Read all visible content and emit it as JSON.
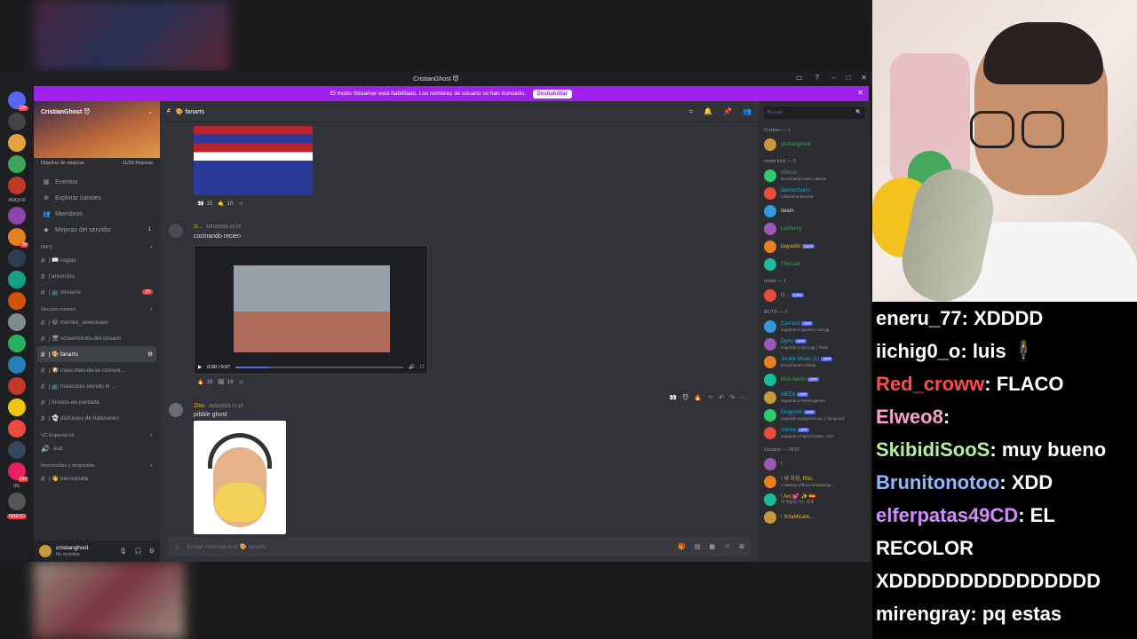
{
  "app": {
    "window_title": "CristianGhost 😈",
    "streamer_banner": "El modo Streamer está habilitado. Los nombres de usuario se han truncado.",
    "streamer_button": "Deshabilitar"
  },
  "servers": [
    {
      "badge": "226"
    },
    {
      "badge": ""
    },
    {
      "badge": ""
    },
    {
      "badge": ""
    },
    {
      "badge": ""
    },
    {
      "badge": ""
    },
    {
      "badge": "28"
    },
    {
      "badge": ""
    },
    {
      "badge": ""
    },
    {
      "badge": ""
    },
    {
      "badge": ""
    },
    {
      "badge": ""
    },
    {
      "badge": ""
    },
    {
      "badge": ""
    },
    {
      "badge": ""
    },
    {
      "badge": ""
    },
    {
      "badge": ""
    },
    {
      "badge": "299"
    },
    {
      "badge": ""
    }
  ],
  "server_labels": {
    "niqui": "4NIQUI2",
    "irl": "IRL",
    "nuevo": "NUEVO"
  },
  "sidebar": {
    "server_name": "CristianGhost 😈",
    "boost_goal": "Objetivo de mejoras",
    "boost_count": "11/28 Mejoras",
    "nav": [
      {
        "icon": "calendar-icon",
        "label": "Eventos"
      },
      {
        "icon": "compass-icon",
        "label": "Explorar canales"
      },
      {
        "icon": "members-icon",
        "label": "Miembros"
      },
      {
        "icon": "boost-icon",
        "label": "Mejoras del servidor",
        "count": "1"
      }
    ],
    "categories": [
      {
        "name": "INFO",
        "channels": [
          {
            "name": "| 📖 reglas",
            "count": ""
          },
          {
            "name": "| anuncios",
            "count": ""
          },
          {
            "name": "| 📺 streams",
            "count": "29"
          }
        ]
      },
      {
        "name": "Sección memes",
        "channels": [
          {
            "name": "| 😂 memes_aweonaso",
            "count": ""
          },
          {
            "name": "| 🖥 screenshots-del-stream",
            "count": ""
          },
          {
            "name": "| 🎨 fanarts",
            "count": "",
            "active": true
          },
          {
            "name": "| 🐶 mascotas-de-la-comuni...",
            "count": ""
          },
          {
            "name": "| 📺 mascotas viendo el ...",
            "count": ""
          },
          {
            "name": "| fondos-de-pantalla",
            "count": ""
          },
          {
            "name": "| 👻 disfraces de halloween",
            "count": ""
          }
        ]
      },
      {
        "name": "VC Especial lol",
        "channels": [
          {
            "name": "asd",
            "count": ""
          }
        ]
      },
      {
        "name": "bienvenidas y despedida",
        "channels": [
          {
            "name": "| 👋 bienvenida",
            "count": ""
          }
        ]
      }
    ],
    "user": {
      "name": "cristianghost",
      "status": "No molestar"
    }
  },
  "chat": {
    "channel": "🎨 fanarts",
    "reactions_1": [
      {
        "emoji": "👀",
        "count": "15"
      },
      {
        "emoji": "🤙",
        "count": "10"
      }
    ],
    "messages": [
      {
        "author": "D...",
        "timestamp": "19/10/2025 10:19",
        "text": "cocinando recien",
        "video_time": "0:00 / 0:07"
      },
      {
        "author": "Zitto",
        "timestamp": "19/10/2025 17:13",
        "text": "pibble ghost"
      }
    ],
    "reactions_2": [
      {
        "emoji": "🔥",
        "count": "18"
      },
      {
        "emoji": "🖼",
        "count": "16"
      }
    ],
    "composer_placeholder": "Enviar mensaje a #| 🎨 fanarts"
  },
  "members": {
    "search_placeholder": "Buscar",
    "groups": [
      {
        "title": "Cristian — 1",
        "members": [
          {
            "name": "cristianghost",
            "status": "",
            "color": "#3ba55c",
            "tag": ""
          }
        ]
      },
      {
        "title": "mods kick — 6",
        "members": [
          {
            "name": "IGhost",
            "status": "Escuchando Men Laborte",
            "color": "#3ba55c",
            "tag": ""
          },
          {
            "name": "laemochurro",
            "status": "sofiachina favorita",
            "color": "#00b0f4",
            "tag": ""
          },
          {
            "name": "latam",
            "status": "",
            "color": "#dbdee1",
            "tag": ""
          },
          {
            "name": "Lechurry",
            "status": "",
            "color": "#3ba55c",
            "tag": ""
          },
          {
            "name": "payasito",
            "status": "",
            "color": "#f0b232",
            "tag": "pone"
          },
          {
            "name": "TheLast",
            "status": "",
            "color": "#3ba55c",
            "tag": ""
          }
        ]
      },
      {
        "title": "mods — 1",
        "members": [
          {
            "name": "G...",
            "status": "",
            "color": "#949ba4",
            "tag": "Sofia"
          }
        ]
      },
      {
        "title": "BOTS — 7",
        "members": [
          {
            "name": "Carl-bot",
            "status": "Jugando a /games | carl.gg",
            "color": "#00b0f4",
            "tag": "APP"
          },
          {
            "name": "Dyno",
            "status": "Jugando a dyno.gg | ?help",
            "color": "#00b0f4",
            "tag": "APP"
          },
          {
            "name": "Jockie Music (1)",
            "status": "Escuchando m!help",
            "color": "#00b0f4",
            "tag": "APP"
          },
          {
            "name": "Kick Alerts",
            "status": "",
            "color": "#3ba55c",
            "tag": "APP"
          },
          {
            "name": "MEE6",
            "status": "Jugando a /mee6-games",
            "color": "#00b0f4",
            "tag": "APP"
          },
          {
            "name": "Pingcord",
            "status": "Jugando a pingcord.xyz | ?pingcord",
            "color": "#00b0f4",
            "tag": "APP"
          },
          {
            "name": "Vortex",
            "status": "Jugando a https://vortex.../vor",
            "color": "#00b0f4",
            "tag": "APP"
          }
        ]
      },
      {
        "title": "Usuario — 3816",
        "members": [
          {
            "name": "!",
            "status": "",
            "color": "#f0b232",
            "tag": ""
          },
          {
            "name": "! 내 차임, Rito.",
            "status": "A destiny without knowledge...",
            "color": "#f0b232",
            "tag": ""
          },
          {
            "name": "! Ani 💕 ✨ 🇪🇸",
            "status": "이 마음이 가는 곳에",
            "color": "#f0b232",
            "tag": ""
          },
          {
            "name": "! SrtaMicatic...",
            "status": "",
            "color": "#f0b232",
            "tag": ""
          }
        ]
      }
    ]
  },
  "twitch_chat": [
    {
      "user": "eneru_77",
      "color": "#ffffff",
      "msg": "XDDDD"
    },
    {
      "user": "iichig0_o",
      "color": "#ffffff",
      "msg": "luis 🕴"
    },
    {
      "user": "Red_croww",
      "color": "#ff4b4b",
      "msg": "FLACO"
    },
    {
      "user": "Elweo8",
      "color": "#ff9ecf",
      "msg": ""
    },
    {
      "user": "SkibidiSooS",
      "color": "#b4f0a0",
      "msg": "muy bueno"
    },
    {
      "user": "Brunitonotoo",
      "color": "#8fb8ff",
      "msg": "XDD"
    },
    {
      "user": "elferpatas49CD",
      "color": "#d28bff",
      "msg": "EL RECOLOR XDDDDDDDDDDDDDDD"
    },
    {
      "user": "mirengray",
      "color": "#ffffff",
      "msg": "pq estas"
    }
  ]
}
